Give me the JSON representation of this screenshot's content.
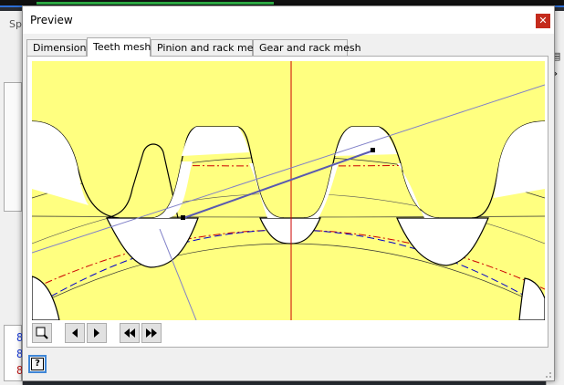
{
  "background_app": {
    "panel_title": "Sp",
    "numbers": [
      "8",
      "8",
      "8"
    ],
    "number_colors": [
      "#1a3bd6",
      "#1a3bd6",
      "#c01818"
    ],
    "right_glyph": "»"
  },
  "dialog": {
    "title": "Preview",
    "close_icon": "close-icon"
  },
  "tabs": [
    {
      "label": "Dimensions",
      "active": false
    },
    {
      "label": "Teeth mesh",
      "active": true
    },
    {
      "label": "Pinion and rack mesh",
      "active": false
    },
    {
      "label": "Gear and rack mesh",
      "active": false
    }
  ],
  "toolbar": {
    "buttons": [
      {
        "icon": "zoom-icon"
      },
      {
        "icon": "step-back-icon"
      },
      {
        "icon": "step-forward-icon"
      },
      {
        "icon": "rewind-icon"
      },
      {
        "icon": "fast-forward-icon"
      }
    ]
  },
  "help": {
    "icon": "help-icon",
    "glyph": "?"
  },
  "colors": {
    "canvas_bg": "#ffff80",
    "tooth_fill": "#ffffff",
    "outline": "#000000",
    "center_line": "#cc0000",
    "pitch_red": "#cc0000",
    "pitch_blue": "#0000cc",
    "action_line": "#7f7fd6"
  }
}
